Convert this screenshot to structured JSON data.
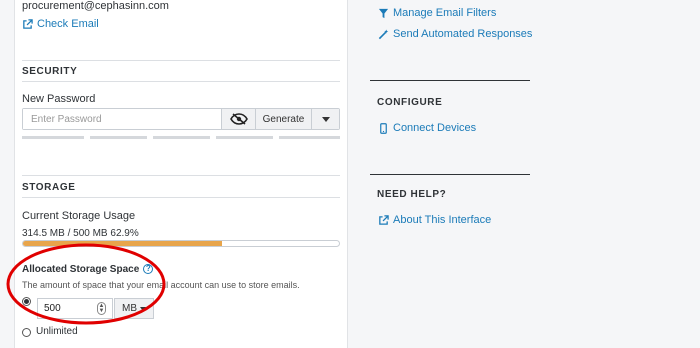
{
  "account": {
    "email": "procurement@cephasinn.com",
    "check_email_label": "Check Email"
  },
  "security": {
    "title": "SECURITY",
    "new_password_label": "New Password",
    "password_placeholder": "Enter Password",
    "generate_label": "Generate"
  },
  "storage": {
    "title": "STORAGE",
    "current_usage_label": "Current Storage Usage",
    "usage_text": "314.5 MB / 500 MB 62.9%",
    "usage_percent": 62.9,
    "allocated_label": "Allocated Storage Space",
    "help_symbol": "?",
    "description": "The amount of space that your email account can use to store emails.",
    "quota_value": "500",
    "unit": "MB",
    "unlimited_label": "Unlimited"
  },
  "sidebar": {
    "manage_filters_label": "Manage Email Filters",
    "automated_responses_label": "Send Automated Responses",
    "configure_title": "CONFIGURE",
    "connect_devices_label": "Connect Devices",
    "need_help_title": "NEED HELP?",
    "about_interface_label": "About This Interface"
  },
  "colors": {
    "link": "#1b7bb8",
    "progress": "#e8a54b",
    "annotation": "#e00000"
  },
  "icons": [
    "external-link-icon",
    "eye-slash-icon",
    "caret-down-icon",
    "filter-icon",
    "wand-icon",
    "mobile-icon",
    "help-icon"
  ]
}
